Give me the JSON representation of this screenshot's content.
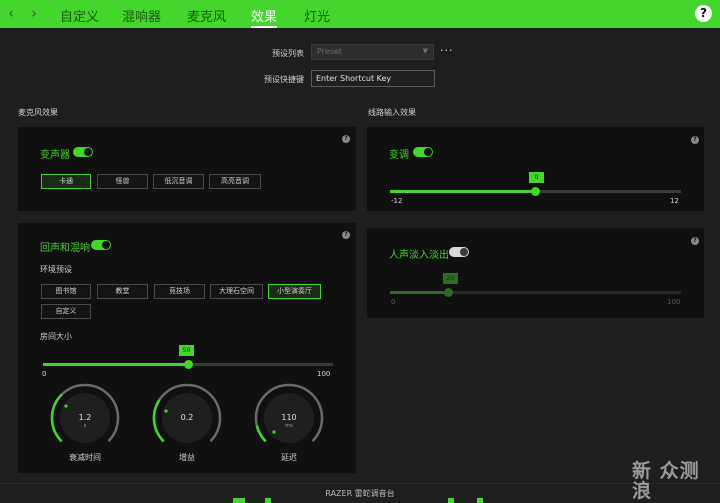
{
  "nav": {
    "back_icon": "chevron-left-icon",
    "forward_icon": "chevron-right-icon",
    "back_glyph": "‹",
    "forward_glyph": "›",
    "tabs": [
      {
        "label": "自定义"
      },
      {
        "label": "混响器"
      },
      {
        "label": "麦克风"
      },
      {
        "label": "效果",
        "active": true
      },
      {
        "label": "灯光"
      }
    ],
    "help_glyph": "?"
  },
  "preset": {
    "list_label": "预设列表",
    "value": "Preset",
    "more_glyph": "···",
    "shortcut_label": "预设快捷键",
    "shortcut_value": "Enter Shortcut Key"
  },
  "mic_effects": {
    "title": "麦克风效果",
    "voice_changer": {
      "title": "变声器",
      "enabled": true,
      "options": [
        "卡通",
        "怪兽",
        "低沉音调",
        "高亮音调"
      ],
      "selected": "卡通"
    },
    "echo_reverb": {
      "title": "回声和混响",
      "enabled": true,
      "env_label": "环境预设",
      "environments": [
        "图书馆",
        "教堂",
        "竞技场",
        "大理石空间",
        "小型演奏厅",
        "自定义"
      ],
      "selected": "小型演奏厅",
      "room_label": "房间大小",
      "room_size": 50,
      "room_min": "0",
      "room_max": "100",
      "room_value_text": "50",
      "knobs": [
        {
          "value": "1.2",
          "unit": "s",
          "caption": "衰减时间"
        },
        {
          "value": "0.2",
          "unit": "",
          "caption": "增益"
        },
        {
          "value": "110",
          "unit": "ms",
          "caption": "延迟"
        }
      ]
    }
  },
  "line_in_effects": {
    "title": "线路输入效果",
    "pitch": {
      "title": "变调",
      "enabled": true,
      "value": 0,
      "value_text": "0",
      "min": "-12",
      "max": "12"
    },
    "voice_fade": {
      "title": "人声淡入淡出",
      "enabled": false,
      "value": 20,
      "value_text": "20",
      "min": "0",
      "max": "100"
    }
  },
  "footer": {
    "label": "RAZER 雷蛇调音台"
  },
  "watermark": {
    "line1": "新 众测",
    "line2": "浪"
  },
  "colors": {
    "accent": "#44d62c",
    "background": "#1e1e1e",
    "panel": "#101010"
  }
}
